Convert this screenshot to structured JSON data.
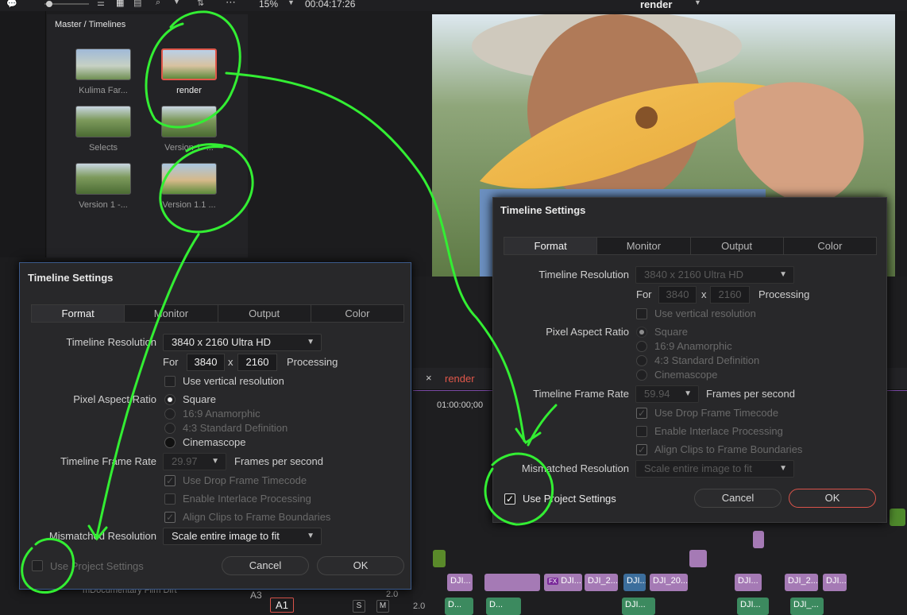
{
  "topbar": {
    "zoom": "15%",
    "timecode": "00:04:17:26",
    "viewer_title": "render"
  },
  "media_pool": {
    "breadcrumb": "Master / Timelines",
    "clips": [
      {
        "label": "Kulima Far...",
        "style": "person"
      },
      {
        "label": "render",
        "style": "person",
        "selected": true
      },
      {
        "label": "Selects",
        "style": "landscape"
      },
      {
        "label": "Version 1 -...",
        "style": "landscape"
      },
      {
        "label": "Version 1 -...",
        "style": "landscape"
      },
      {
        "label": "Version 1.1 ...",
        "style": "person"
      }
    ]
  },
  "dialog_left": {
    "title": "Timeline Settings",
    "tabs": [
      "Format",
      "Monitor",
      "Output",
      "Color"
    ],
    "active_tab": "Format",
    "timeline_resolution_label": "Timeline Resolution",
    "timeline_resolution_value": "3840 x 2160 Ultra HD",
    "for_label": "For",
    "width": "3840",
    "x_label": "x",
    "height": "2160",
    "processing_label": "Processing",
    "use_vertical": "Use vertical resolution",
    "pixel_aspect_label": "Pixel Aspect Ratio",
    "pixel_aspect_options": [
      "Square",
      "16:9 Anamorphic",
      "4:3 Standard Definition",
      "Cinemascope"
    ],
    "frame_rate_label": "Timeline Frame Rate",
    "frame_rate_value": "29.97",
    "fps_label": "Frames per second",
    "drop_frame": "Use Drop Frame Timecode",
    "interlace": "Enable Interlace Processing",
    "align_clips": "Align Clips to Frame Boundaries",
    "mismatched_label": "Mismatched Resolution",
    "mismatched_value": "Scale entire image to fit",
    "use_project": "Use Project Settings",
    "cancel": "Cancel",
    "ok": "OK"
  },
  "dialog_right": {
    "title": "Timeline Settings",
    "tabs": [
      "Format",
      "Monitor",
      "Output",
      "Color"
    ],
    "active_tab": "Format",
    "timeline_resolution_label": "Timeline Resolution",
    "timeline_resolution_value": "3840 x 2160 Ultra HD",
    "for_label": "For",
    "width": "3840",
    "x_label": "x",
    "height": "2160",
    "processing_label": "Processing",
    "use_vertical": "Use vertical resolution",
    "pixel_aspect_label": "Pixel Aspect Ratio",
    "pixel_aspect_options": [
      "Square",
      "16:9 Anamorphic",
      "4:3 Standard Definition",
      "Cinemascope"
    ],
    "frame_rate_label": "Timeline Frame Rate",
    "frame_rate_value": "59.94",
    "fps_label": "Frames per second",
    "drop_frame": "Use Drop Frame Timecode",
    "interlace": "Enable Interlace Processing",
    "align_clips": "Align Clips to Frame Boundaries",
    "mismatched_label": "Mismatched Resolution",
    "mismatched_value": "Scale entire image to fit",
    "use_project": "Use Project Settings",
    "cancel": "Cancel",
    "ok": "OK"
  },
  "timeline": {
    "tab_label": "render",
    "timecode": "01:00:00;00",
    "clip_labels": [
      "DJI...",
      "DJI...",
      "DJI_2...",
      "DJI...",
      "DJI_20...",
      "DJI...",
      "DJI_2...",
      "DJI..."
    ],
    "audio_clips": [
      "D...",
      "D...",
      "DJI...",
      "DJI...",
      "DJI_..."
    ],
    "track_label": "A1",
    "track_a3": "A3",
    "volume": "2.0",
    "volume2": "2.0",
    "s_label": "S",
    "m_label": "M",
    "bin_label": "mDocumentary Film Dirt",
    "fx_badge": "FX"
  },
  "colors": {
    "accent_red": "#e0574a",
    "annotation_green": "#33ee33",
    "clip_purple": "#a57ab5"
  }
}
